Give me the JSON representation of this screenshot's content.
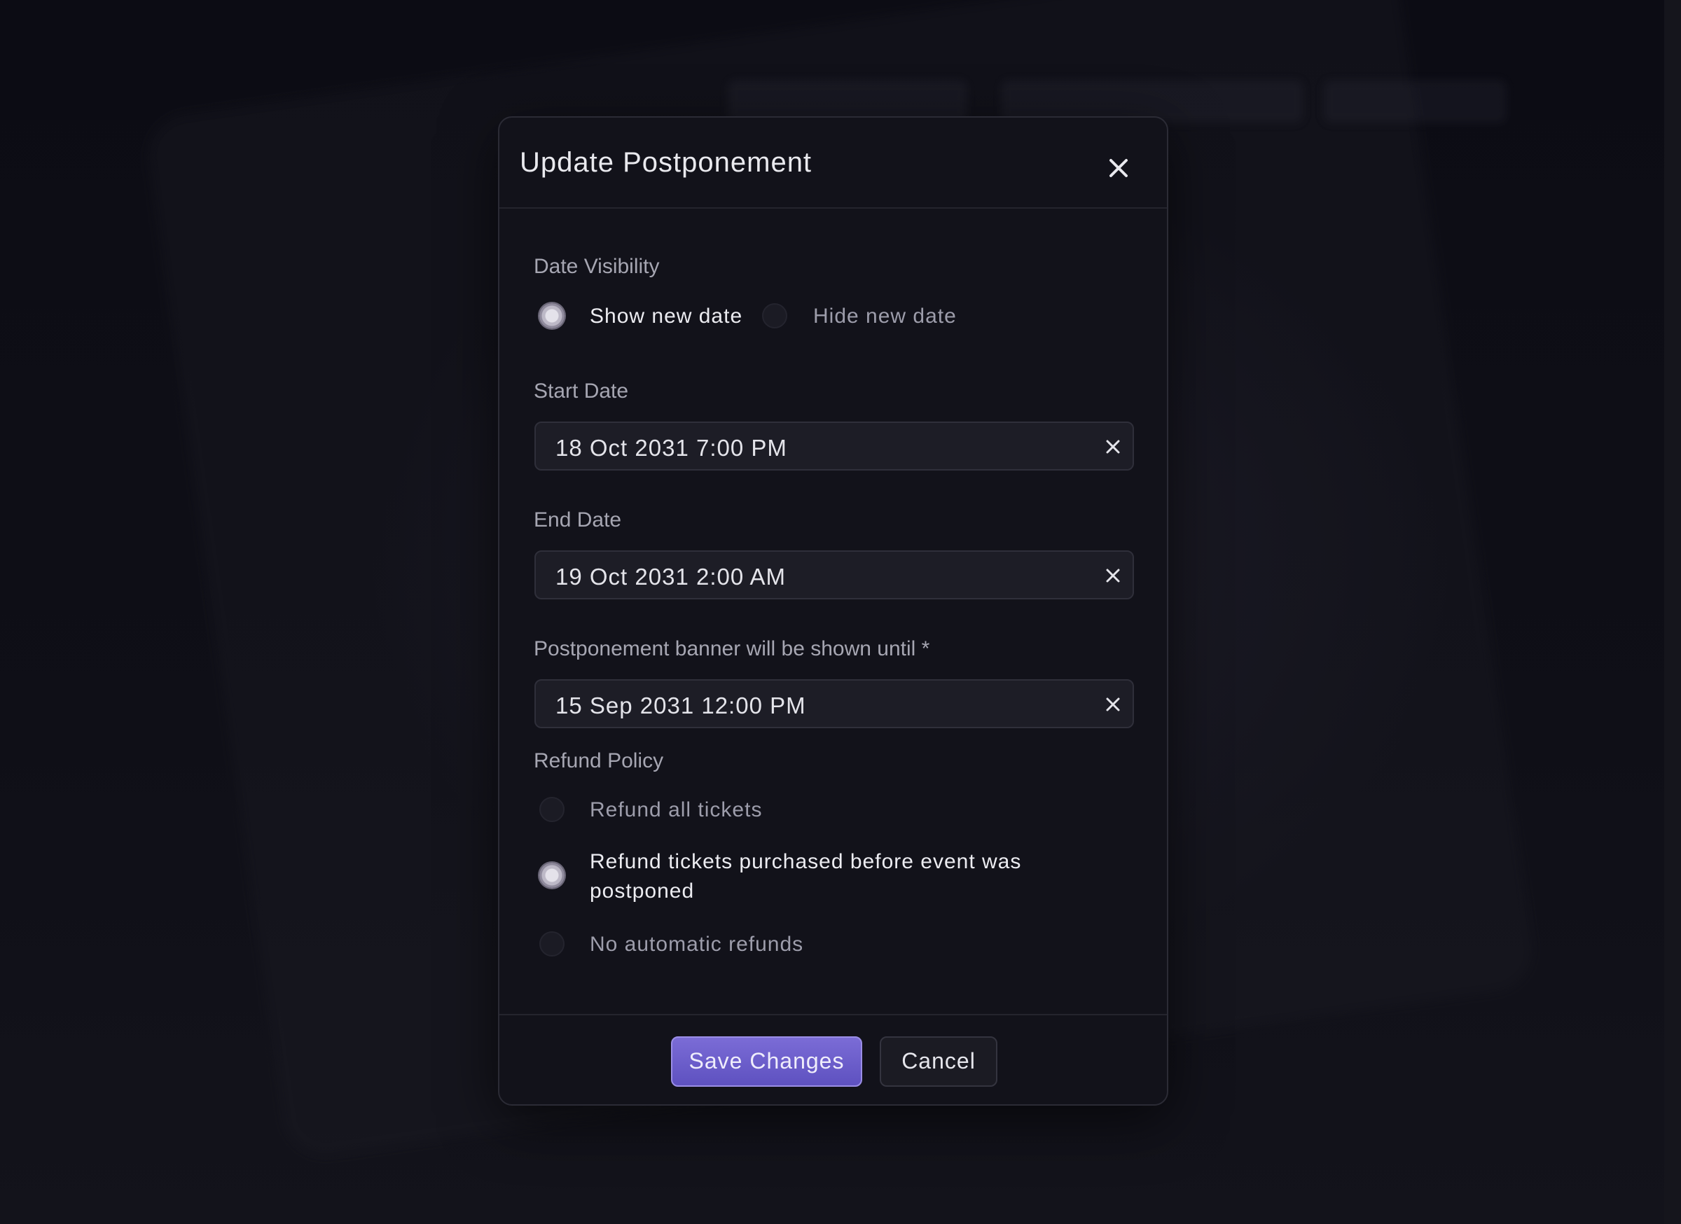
{
  "modal": {
    "title": "Update Postponement",
    "close_icon": "close-icon"
  },
  "date_visibility": {
    "label": "Date Visibility",
    "options": [
      {
        "label": "Show new date",
        "selected": true
      },
      {
        "label": "Hide new date",
        "selected": false
      }
    ]
  },
  "start_date": {
    "label": "Start Date",
    "value": "18 Oct 2031 7:00 PM",
    "clear_icon": "clear-icon"
  },
  "end_date": {
    "label": "End Date",
    "value": "19 Oct 2031 2:00 AM",
    "clear_icon": "clear-icon"
  },
  "banner_until": {
    "label": "Postponement banner will be shown until *",
    "value": "15 Sep 2031 12:00 PM",
    "clear_icon": "clear-icon"
  },
  "refund_policy": {
    "label": "Refund Policy",
    "options": [
      {
        "label": "Refund all tickets",
        "selected": false
      },
      {
        "label": "Refund tickets purchased before event was",
        "label_line2": "postponed",
        "selected": true
      },
      {
        "label": "No automatic refunds",
        "selected": false
      }
    ]
  },
  "footer": {
    "save_label": "Save Changes",
    "cancel_label": "Cancel"
  },
  "colors": {
    "background": "#0c0c12",
    "modal": "#12121a",
    "accent": "#6a5cc9",
    "field": "#1d1d26"
  }
}
